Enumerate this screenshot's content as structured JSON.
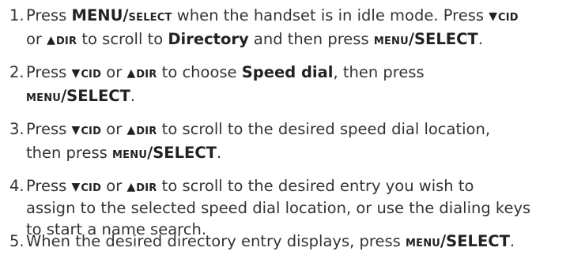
{
  "steps": [
    {
      "number": "1.",
      "line1": {
        "t1": "Press ",
        "b1": "MENU/",
        "s1": "SELECT",
        "t2": " when the handset is in idle mode. Press ",
        "i1": "▼",
        "k1": "CID"
      },
      "line2": {
        "t1": "or ",
        "i1": "▲",
        "k1": "DIR",
        "t2": "  to scroll to ",
        "b1": "Directory",
        "t3": " and then press ",
        "s1": "MENU",
        "b2": "/SELECT",
        "t4": "."
      }
    },
    {
      "number": "2.",
      "line1": {
        "t1": "Press ",
        "i1": "▼",
        "k1": "CID",
        "t2": " or ",
        "i2": "▲",
        "k2": "DIR",
        "t3": " to choose ",
        "b1": "Speed dial",
        "t4": ", then press"
      },
      "line2": {
        "s1": "MENU",
        "b1": "/SELECT",
        "t1": "."
      }
    },
    {
      "number": "3.",
      "line1": {
        "t1": "Press ",
        "i1": "▼",
        "k1": "CID",
        "t2": " or ",
        "i2": "▲",
        "k2": "DIR",
        "t3": " to scroll to the desired speed dial location,"
      },
      "line2": {
        "t1": "then press ",
        "s1": "MENU",
        "b1": "/SELECT",
        "t2": "."
      }
    },
    {
      "number": "4.",
      "line1": {
        "t1": "Press ",
        "i1": "▼",
        "k1": "CID",
        "t2": " or ",
        "i2": "▲",
        "k2": "DIR",
        "t3": " to scroll to the desired entry you wish to"
      },
      "line2": {
        "t1": "assign to the selected speed dial location, or use the dialing keys"
      },
      "line3": {
        "t1": "to start a name search."
      }
    },
    {
      "number": "5.",
      "line1": {
        "t1": "When the desired directory entry displays, press ",
        "s1": "MENU",
        "b1": "/SELECT",
        "t2": "."
      }
    }
  ]
}
